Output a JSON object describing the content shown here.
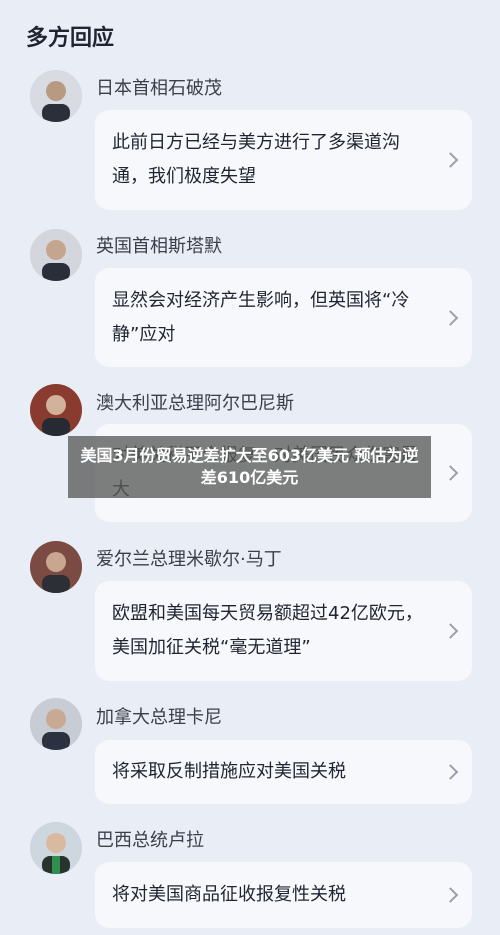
{
  "section_title": "多方回应",
  "responses": [
    {
      "name": "日本首相石破茂",
      "quote": "此前日方已经与美方进行了多渠道沟通，我们极度失望",
      "avatar_icon": "person-avatar-icon"
    },
    {
      "name": "英国首相斯塔默",
      "quote": "显然会对经济产生影响，但英国将“冷静”应对",
      "avatar_icon": "person-avatar-icon"
    },
    {
      "name": "澳大利亚总理阿尔巴尼斯",
      "quote": "对美关税不会报复，对美国民众伤害最大",
      "avatar_icon": "person-avatar-icon"
    },
    {
      "name": "爱尔兰总理米歇尔·马丁",
      "quote": "欧盟和美国每天贸易额超过42亿欧元，美国加征关税“毫无道理”",
      "avatar_icon": "person-avatar-icon"
    },
    {
      "name": "加拿大总理卡尼",
      "quote": "将采取反制措施应对美国关税",
      "avatar_icon": "person-avatar-icon"
    },
    {
      "name": "巴西总统卢拉",
      "quote": "将对美国商品征收报复性关税",
      "avatar_icon": "person-avatar-icon"
    }
  ],
  "overlay_caption": "美国3月份贸易逆差扩大至603亿美元 预估为逆差610亿美元",
  "colors": {
    "background": "#e9edf5",
    "card": "#f7f8fb",
    "text": "#1f2430"
  }
}
